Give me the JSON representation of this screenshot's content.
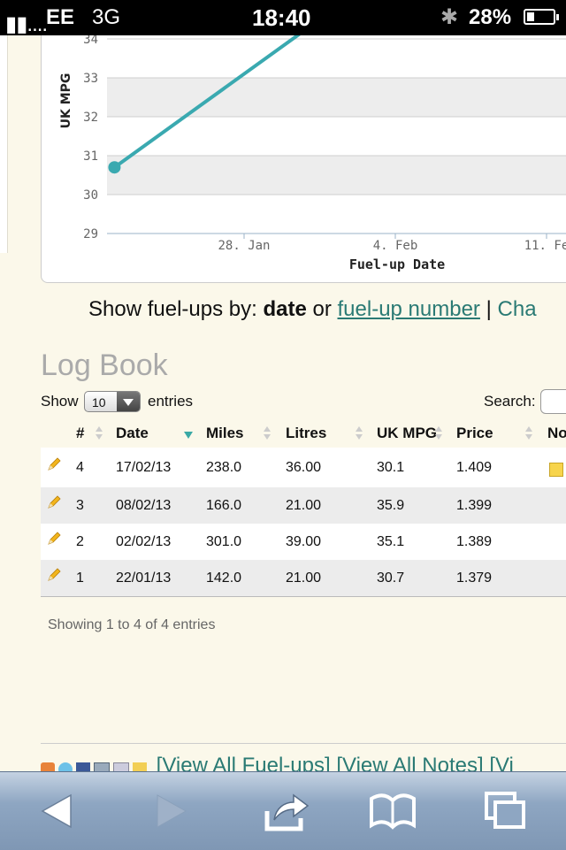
{
  "status_bar": {
    "signal": "▮▮....",
    "carrier": "EE",
    "network": "3G",
    "time": "18:40",
    "bluetooth_icon": "bluetooth-icon",
    "battery": "28%",
    "battery_level": 0.28
  },
  "chart_data": {
    "type": "line",
    "ylabel": "UK MPG",
    "xlabel": "Fuel-up Date",
    "y_ticks": [
      "29",
      "30",
      "31",
      "32",
      "33",
      "34"
    ],
    "x_ticks": [
      "28. Jan",
      "4. Feb",
      "11. Fe"
    ],
    "ylim": [
      29,
      34
    ],
    "series": [
      {
        "points": [
          {
            "x": "2013-01-22",
            "y": 30.7
          },
          {
            "x": "2013-02-02",
            "y": 35.1
          }
        ]
      }
    ],
    "line_color": "#3aa9b0",
    "grid": true
  },
  "show_by": {
    "prefix": "Show fuel-ups by:",
    "current": "date",
    "or": "or",
    "alt_link": "fuel-up number",
    "sep": "|",
    "cut_link": "Cha"
  },
  "logbook": {
    "title": "Log Book",
    "show_label": "Show",
    "page_size": "10",
    "entries_label": "entries",
    "search_label": "Search:",
    "search_value": "",
    "columns": [
      "#",
      "Date",
      "Miles",
      "Litres",
      "UK MPG",
      "Price",
      "No"
    ],
    "rows": [
      {
        "num": "4",
        "date": "17/02/13",
        "miles": "238.0",
        "litres": "36.00",
        "mpg": "30.1",
        "price": "1.409",
        "has_note": true
      },
      {
        "num": "3",
        "date": "08/02/13",
        "miles": "166.0",
        "litres": "21.00",
        "mpg": "35.9",
        "price": "1.399",
        "has_note": false
      },
      {
        "num": "2",
        "date": "02/02/13",
        "miles": "301.0",
        "litres": "39.00",
        "mpg": "35.1",
        "price": "1.389",
        "has_note": false
      },
      {
        "num": "1",
        "date": "22/01/13",
        "miles": "142.0",
        "litres": "21.00",
        "mpg": "30.7",
        "price": "1.379",
        "has_note": false
      }
    ],
    "info": "Showing 1 to 4 of 4 entries"
  },
  "footer": {
    "link1": "[View All Fuel-ups]",
    "link2": "[View All Notes]",
    "link3": "[Vi"
  },
  "colors": {
    "accent": "#2a7a74",
    "line": "#3aa9b0",
    "page_bg": "#fbf8ea"
  }
}
